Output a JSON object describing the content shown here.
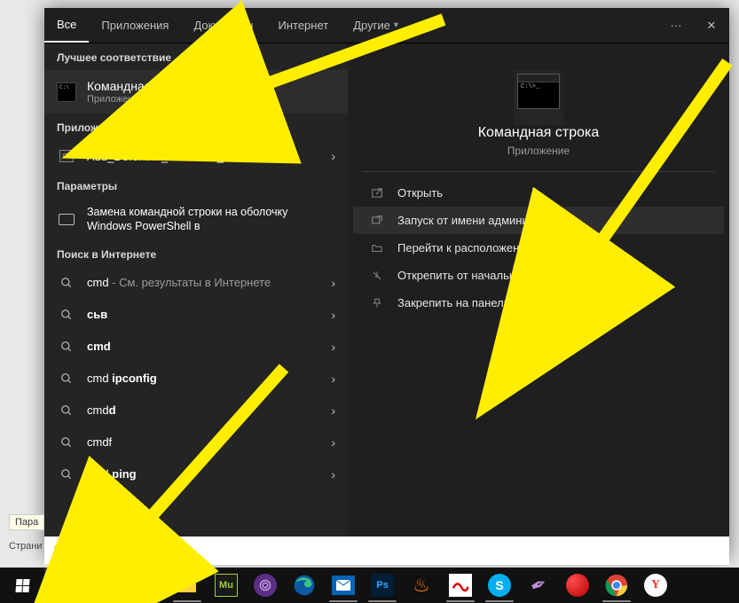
{
  "tabs": {
    "all": "Все",
    "apps": "Приложения",
    "docs": "Документы",
    "web": "Интернет",
    "more": "Другие"
  },
  "left": {
    "best_header": "Лучшее соответствие",
    "best_title": "Командная строка",
    "best_subtitle": "Приложение",
    "apps_header": "Приложения",
    "app1": "Add_Defender_Exclusion_New.cmd",
    "settings_header": "Параметры",
    "setting1": "Замена командной строки на оболочку Windows PowerShell в",
    "web_header": "Поиск в Интернете",
    "web1_pre": "cmd",
    "web1_post": " - См. результаты в Интернете",
    "web2": "сьв",
    "web3": "cmd",
    "web4_a": "cmd ",
    "web4_b": "ipconfig",
    "web5_a": "cmd",
    "web5_b": "d",
    "web6": "cmdf",
    "web7_a": "cmd ",
    "web7_b": "ping"
  },
  "right": {
    "title": "Командная строка",
    "subtitle": "Приложение",
    "a_open": "Открыть",
    "a_admin": "Запуск от имени администратора",
    "a_location": "Перейти к расположению файла",
    "a_unpin_start": "Открепить от начального экрана",
    "a_pin_tb": "Закрепить на панели задач"
  },
  "search": {
    "query": "cmd"
  },
  "bg": {
    "tooltip": "Пара",
    "crumb": "Страни"
  },
  "colors": {
    "yellow": "#ffee00"
  }
}
